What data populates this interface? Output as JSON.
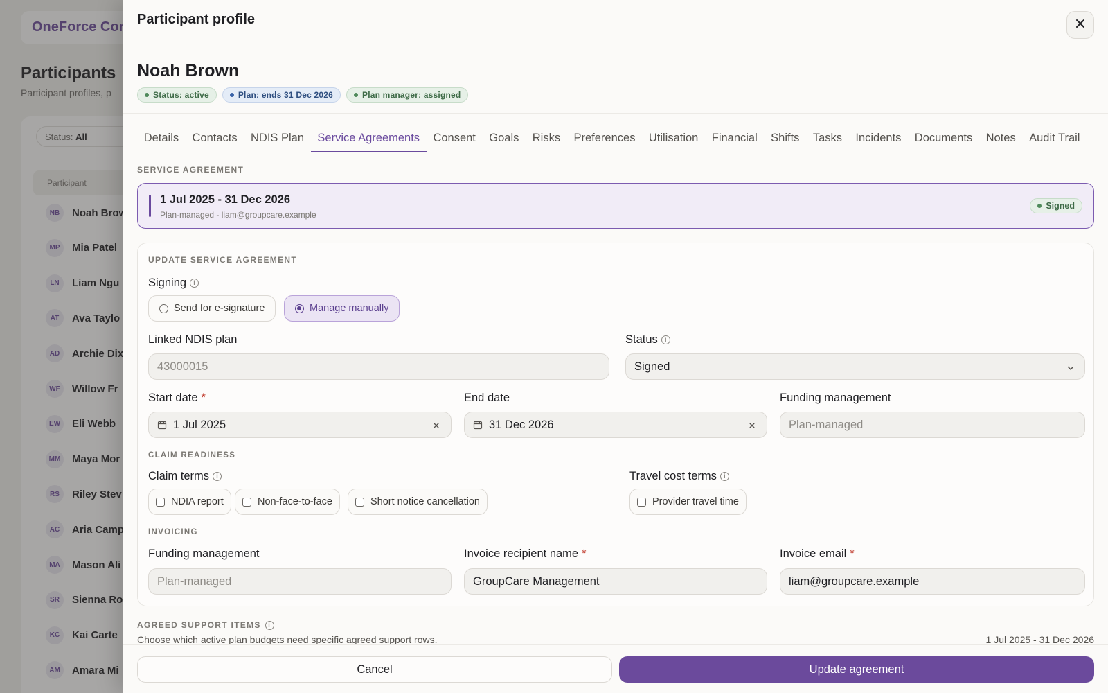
{
  "background": {
    "app_logo": "OneForce Con",
    "page_title": "Participants",
    "page_subtitle": "Participant profiles, p",
    "filter_label": "Status:",
    "filter_value": "All",
    "table_header": "Participant",
    "rows": [
      {
        "initials": "NB",
        "name": "Noah Brow"
      },
      {
        "initials": "MP",
        "name": "Mia Patel"
      },
      {
        "initials": "LN",
        "name": "Liam Ngu"
      },
      {
        "initials": "AT",
        "name": "Ava Taylo"
      },
      {
        "initials": "AD",
        "name": "Archie Dix"
      },
      {
        "initials": "WF",
        "name": "Willow Fr"
      },
      {
        "initials": "EW",
        "name": "Eli Webb"
      },
      {
        "initials": "MM",
        "name": "Maya Mor"
      },
      {
        "initials": "RS",
        "name": "Riley Stev"
      },
      {
        "initials": "AC",
        "name": "Aria Camp"
      },
      {
        "initials": "MA",
        "name": "Mason Ali"
      },
      {
        "initials": "SR",
        "name": "Sienna Ro"
      },
      {
        "initials": "KC",
        "name": "Kai Carte"
      },
      {
        "initials": "AM",
        "name": "Amara Mi"
      }
    ]
  },
  "drawer": {
    "title": "Participant profile",
    "participant_name": "Noah Brown",
    "badges": [
      {
        "label": "Status: active",
        "tone": "green"
      },
      {
        "label": "Plan: ends 31 Dec 2026",
        "tone": "blue"
      },
      {
        "label": "Plan manager: assigned",
        "tone": "green"
      }
    ],
    "tabs": [
      "Details",
      "Contacts",
      "NDIS Plan",
      "Service Agreements",
      "Consent",
      "Goals",
      "Risks",
      "Preferences",
      "Utilisation",
      "Financial",
      "Shifts",
      "Tasks",
      "Incidents",
      "Documents",
      "Notes",
      "Audit Trail"
    ],
    "active_tab": "Service Agreements"
  },
  "agreement": {
    "section_label": "SERVICE AGREEMENT",
    "title": "1 Jul 2025 - 31 Dec 2026",
    "subtitle": "Plan-managed - liam@groupcare.example",
    "status": "Signed"
  },
  "update": {
    "section_label": "UPDATE SERVICE AGREEMENT",
    "signing_label": "Signing",
    "signing_options": [
      {
        "label": "Send for e-signature",
        "selected": false
      },
      {
        "label": "Manage manually",
        "selected": true
      }
    ],
    "linked_plan_label": "Linked NDIS plan",
    "linked_plan_value": "43000015",
    "status_label": "Status",
    "status_value": "Signed",
    "start_date_label": "Start date",
    "start_date_value": "1 Jul 2025",
    "end_date_label": "End date",
    "end_date_value": "31 Dec 2026",
    "funding_label": "Funding management",
    "funding_placeholder": "Plan-managed",
    "claim_section_label": "CLAIM READINESS",
    "claim_terms_label": "Claim terms",
    "claim_terms": [
      "NDIA report",
      "Non-face-to-face",
      "Short notice cancellation"
    ],
    "travel_terms_label": "Travel cost terms",
    "travel_terms": [
      "Provider travel time"
    ],
    "invoicing_label": "INVOICING",
    "invoice_funding_label": "Funding management",
    "invoice_funding_placeholder": "Plan-managed",
    "invoice_recipient_label": "Invoice recipient name",
    "invoice_recipient_value": "GroupCare Management",
    "invoice_email_label": "Invoice email",
    "invoice_email_value": "liam@groupcare.example"
  },
  "support": {
    "section_label": "AGREED SUPPORT ITEMS",
    "description": "Choose which active plan budgets need specific agreed support rows.",
    "date_range": "1 Jul 2025 - 31 Dec 2026"
  },
  "footer": {
    "cancel_label": "Cancel",
    "submit_label": "Update agreement"
  },
  "colors": {
    "accent": "#6b4a9c",
    "success": "#4f8a5b",
    "info": "#3a63a8",
    "required": "#c0392b"
  },
  "icons": [
    "close-icon",
    "info-icon",
    "calendar-icon",
    "clear-icon",
    "chevron-down-icon"
  ]
}
